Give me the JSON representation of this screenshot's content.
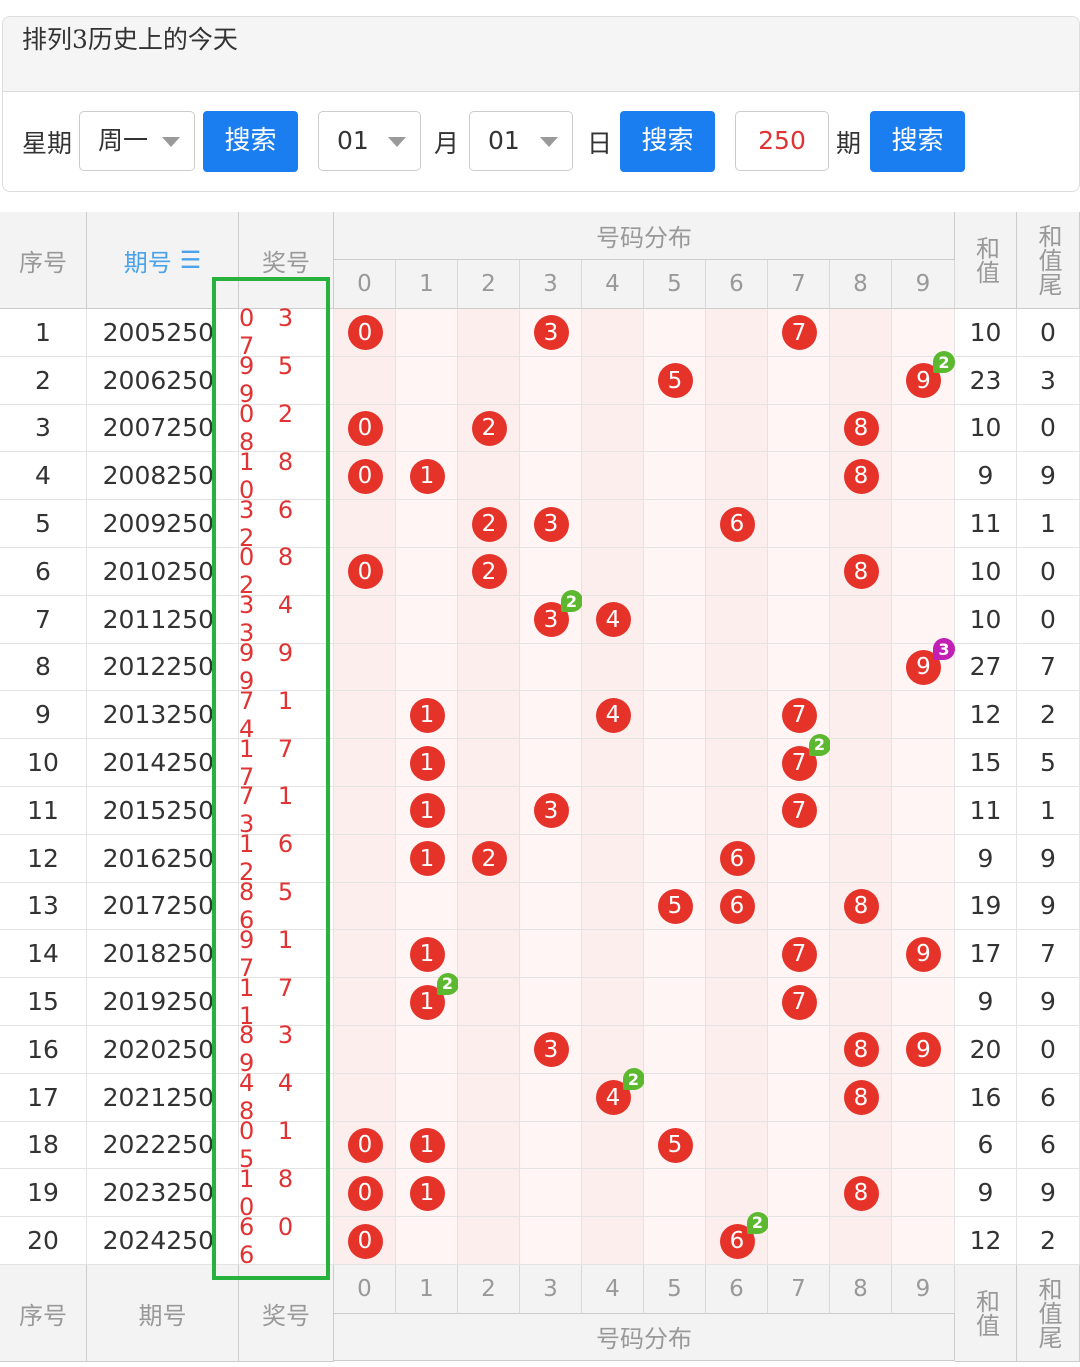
{
  "panel": {
    "title": "排列3历史上的今天"
  },
  "search": {
    "week_label": "星期",
    "week_value": "周一",
    "search_label": "搜索",
    "month_value": "01",
    "month_label": "月",
    "day_value": "01",
    "day_label": "日",
    "issue_value": "250",
    "issue_label": "期"
  },
  "table": {
    "headers": {
      "index": "序号",
      "issue": "期号",
      "sort_icon": "☰",
      "code": "奖号",
      "dist": "号码分布",
      "sum": "和值",
      "sum_tail": "和值尾"
    },
    "digits": [
      "0",
      "1",
      "2",
      "3",
      "4",
      "5",
      "6",
      "7",
      "8",
      "9"
    ],
    "rows": [
      {
        "idx": "1",
        "issue": "2005250",
        "code": "0 3 7",
        "sum": "10",
        "tail": "0",
        "balls": [
          0,
          3,
          7
        ],
        "rep": []
      },
      {
        "idx": "2",
        "issue": "2006250",
        "code": "9 5 9",
        "sum": "23",
        "tail": "3",
        "balls": [
          5,
          9
        ],
        "rep": [
          [
            9,
            "2",
            "green"
          ]
        ]
      },
      {
        "idx": "3",
        "issue": "2007250",
        "code": "0 2 8",
        "sum": "10",
        "tail": "0",
        "balls": [
          0,
          2,
          8
        ],
        "rep": []
      },
      {
        "idx": "4",
        "issue": "2008250",
        "code": "1 8 0",
        "sum": "9",
        "tail": "9",
        "balls": [
          0,
          1,
          8
        ],
        "rep": []
      },
      {
        "idx": "5",
        "issue": "2009250",
        "code": "3 6 2",
        "sum": "11",
        "tail": "1",
        "balls": [
          2,
          3,
          6
        ],
        "rep": []
      },
      {
        "idx": "6",
        "issue": "2010250",
        "code": "0 8 2",
        "sum": "10",
        "tail": "0",
        "balls": [
          0,
          2,
          8
        ],
        "rep": []
      },
      {
        "idx": "7",
        "issue": "2011250",
        "code": "3 4 3",
        "sum": "10",
        "tail": "0",
        "balls": [
          3,
          4
        ],
        "rep": [
          [
            3,
            "2",
            "green"
          ]
        ]
      },
      {
        "idx": "8",
        "issue": "2012250",
        "code": "9 9 9",
        "sum": "27",
        "tail": "7",
        "balls": [
          9
        ],
        "rep": [
          [
            9,
            "3",
            "purple"
          ]
        ]
      },
      {
        "idx": "9",
        "issue": "2013250",
        "code": "7 1 4",
        "sum": "12",
        "tail": "2",
        "balls": [
          1,
          4,
          7
        ],
        "rep": []
      },
      {
        "idx": "10",
        "issue": "2014250",
        "code": "1 7 7",
        "sum": "15",
        "tail": "5",
        "balls": [
          1,
          7
        ],
        "rep": [
          [
            7,
            "2",
            "green"
          ]
        ]
      },
      {
        "idx": "11",
        "issue": "2015250",
        "code": "7 1 3",
        "sum": "11",
        "tail": "1",
        "balls": [
          1,
          3,
          7
        ],
        "rep": []
      },
      {
        "idx": "12",
        "issue": "2016250",
        "code": "1 6 2",
        "sum": "9",
        "tail": "9",
        "balls": [
          1,
          2,
          6
        ],
        "rep": []
      },
      {
        "idx": "13",
        "issue": "2017250",
        "code": "8 5 6",
        "sum": "19",
        "tail": "9",
        "balls": [
          5,
          6,
          8
        ],
        "rep": []
      },
      {
        "idx": "14",
        "issue": "2018250",
        "code": "9 1 7",
        "sum": "17",
        "tail": "7",
        "balls": [
          1,
          7,
          9
        ],
        "rep": []
      },
      {
        "idx": "15",
        "issue": "2019250",
        "code": "1 7 1",
        "sum": "9",
        "tail": "9",
        "balls": [
          1,
          7
        ],
        "rep": [
          [
            1,
            "2",
            "green"
          ]
        ]
      },
      {
        "idx": "16",
        "issue": "2020250",
        "code": "8 3 9",
        "sum": "20",
        "tail": "0",
        "balls": [
          3,
          8,
          9
        ],
        "rep": []
      },
      {
        "idx": "17",
        "issue": "2021250",
        "code": "4 4 8",
        "sum": "16",
        "tail": "6",
        "balls": [
          4,
          8
        ],
        "rep": [
          [
            4,
            "2",
            "green"
          ]
        ]
      },
      {
        "idx": "18",
        "issue": "2022250",
        "code": "0 1 5",
        "sum": "6",
        "tail": "6",
        "balls": [
          0,
          1,
          5
        ],
        "rep": []
      },
      {
        "idx": "19",
        "issue": "2023250",
        "code": "1 8 0",
        "sum": "9",
        "tail": "9",
        "balls": [
          0,
          1,
          8
        ],
        "rep": []
      },
      {
        "idx": "20",
        "issue": "2024250",
        "code": "6 0 6",
        "sum": "12",
        "tail": "2",
        "balls": [
          0,
          6
        ],
        "rep": [
          [
            6,
            "2",
            "green"
          ]
        ]
      }
    ]
  },
  "colors": {
    "ball": "#e5332a",
    "badge_green": "#5cb82e",
    "badge_purple": "#c21fb5",
    "highlight_box": "#27b23e",
    "button": "#1a7ef0"
  }
}
